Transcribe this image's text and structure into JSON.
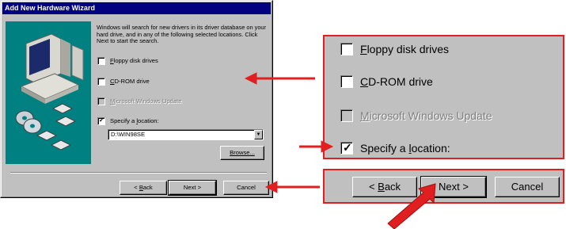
{
  "dialog": {
    "title": "Add New Hardware Wizard",
    "intro": "Windows will search for new drivers in its driver database on your hard drive, and in any of the following selected locations. Click Next to start the search.",
    "options": [
      {
        "label": "Floppy disk drives",
        "accel": "F",
        "rest": "loppy disk drives",
        "checked": false,
        "enabled": true
      },
      {
        "label": "CD-ROM drive",
        "accel": "C",
        "rest": "D-ROM drive",
        "checked": false,
        "enabled": true
      },
      {
        "label": "Microsoft Windows Update",
        "accel": "M",
        "rest": "icrosoft Windows Update",
        "checked": false,
        "enabled": false
      },
      {
        "label": "Specify a location:",
        "pre": "Specify a ",
        "accel": "l",
        "rest": "ocation:",
        "checked": true,
        "enabled": true
      }
    ],
    "location_value": "D:\\WIN98SE",
    "browse_label": "Browse...",
    "back_label": "< Back",
    "back_pre": "< ",
    "back_accel": "B",
    "back_rest": "ack",
    "next_label": "Next >",
    "cancel_label": "Cancel"
  },
  "zoom": {
    "options": [
      {
        "accel": "F",
        "rest": "loppy disk drives"
      },
      {
        "accel": "C",
        "rest": "D-ROM drive"
      },
      {
        "accel": "M",
        "rest": "icrosoft Windows Update"
      },
      {
        "pre": "Specify a ",
        "accel": "l",
        "rest": "ocation:"
      }
    ],
    "back_pre": "< ",
    "back_accel": "B",
    "back_rest": "ack",
    "next_label": "Next >",
    "cancel_label": "Cancel"
  },
  "colors": {
    "window_face": "#c0c0c0",
    "title_bar": "#000080",
    "annotation": "#e02020"
  },
  "icons": [
    "checkbox-check-icon",
    "dropdown-arrow-icon",
    "computer-illustration",
    "cd-disc-icon",
    "callout-arrow-icon",
    "pointer-arrow-icon"
  ]
}
